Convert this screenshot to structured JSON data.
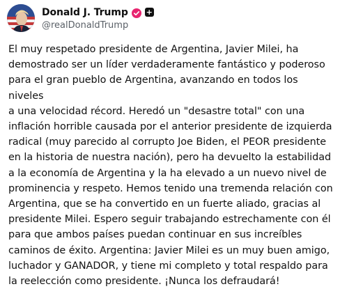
{
  "author": {
    "display_name": "Donald J. Trump",
    "handle": "@realDonaldTrump",
    "avatar_icon": "profile-photo",
    "verified_icon": "verified-badge-icon",
    "badge_icon": "plus-icon",
    "verified_color": "#e8246f"
  },
  "post": {
    "text": "El muy respetado presidente de Argentina, Javier Milei, ha\ndemostrado ser un líder verdaderamente fantástico y poderoso\npara el gran pueblo de Argentina, avanzando en todos los niveles\na una velocidad récord. Heredó un \"desastre total\" con una\ninflación horrible causada por el anterior presidente de izquierda\nradical (muy parecido al corrupto Joe Biden, el PEOR presidente\nen la historia de nuestra nación), pero ha devuelto la estabilidad\na la economía de Argentina y la ha elevado a un nuevo nivel de\nprominencia y respeto. Hemos tenido una tremenda relación con\nArgentina, que se ha convertido en un fuerte aliado, gracias al\npresidente Milei. Espero seguir trabajando estrechamente con él\npara que ambos países puedan continuar en sus increíbles\ncaminos de éxito. Argentina: Javier Milei es un muy buen amigo,\nluchador y GANADOR, y tiene mi completo y total respaldo para\nla reelección como presidente. ¡Nunca los defraudará!"
  }
}
